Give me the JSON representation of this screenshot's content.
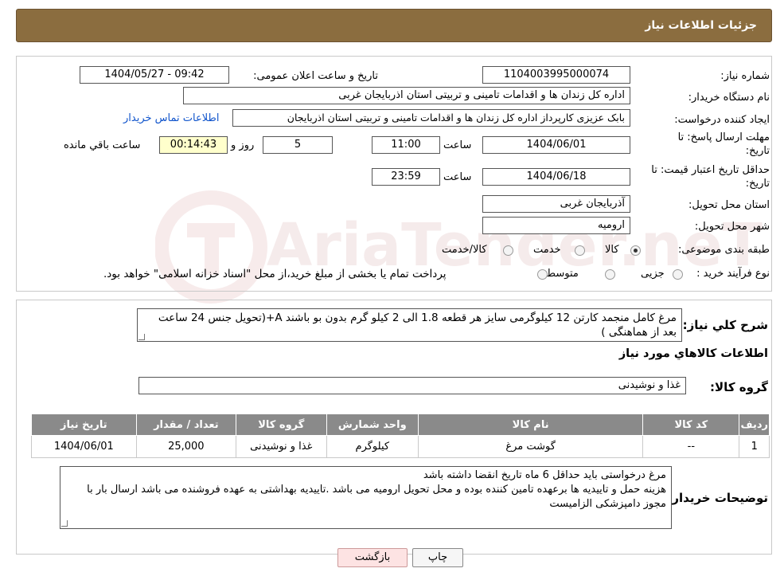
{
  "header": {
    "title": "جزئیات اطلاعات نیاز"
  },
  "form": {
    "need_number_label": "شماره نیاز:",
    "need_number": "1104003995000074",
    "announce_label": "تاریخ و ساعت اعلان عمومی:",
    "announce_value": "1404/05/27 - 09:42",
    "buyer_org_label": "نام دستگاه خریدار:",
    "buyer_org": "اداره کل زندان ها و اقدامات تامینی و تربیتی استان اذربایجان غربی",
    "creator_label": "ایجاد کننده درخواست:",
    "creator": "بابک عزیزی کارپرداز اداره کل زندان ها و اقدامات تامینی و تربیتی استان اذربایجان",
    "contact_link": "اطلاعات تماس خریدار",
    "deadline_label_1": "مهلت ارسال پاسخ: تا",
    "deadline_label_2": "تاریخ:",
    "deadline_date": "1404/06/01",
    "time_label": "ساعت",
    "deadline_time": "11:00",
    "days_value": "5",
    "days_label": "روز و",
    "remaining_time": "00:14:43",
    "remaining_label": "ساعت باقي مانده",
    "validity_label_1": "حداقل تاریخ اعتبار قیمت: تا",
    "validity_label_2": "تاریخ:",
    "validity_date": "1404/06/18",
    "validity_time": "23:59",
    "province_label": "استان محل تحویل:",
    "province": "آذربایجان غربی",
    "city_label": "شهر محل تحویل:",
    "city": "ارومیه",
    "category_label": "طبقه بندی موضوعی:",
    "category_options": [
      "کالا",
      "خدمت",
      "کالا/خدمت"
    ],
    "category_selected": "کالا",
    "process_label": "نوع فرآیند خرید :",
    "process_options": [
      "جزیی",
      "متوسط"
    ],
    "process_note": "پرداخت تمام یا بخشی از مبلغ خرید،از محل \"اسناد خزانه اسلامی\" خواهد بود."
  },
  "summary": {
    "label": "شرح كلي نياز:",
    "text": "مرغ کامل منجمد کارتن 12 کیلوگرمی سایز هر قطعه 1.8 الی 2 کیلو گرم بدون بو باشند A+(تحویل جنس 24 ساعت بعد از هماهنگی )"
  },
  "items_section": {
    "title": "اطلاعات كالاهاي مورد نياز",
    "group_label": "گروه کالا:",
    "group_value": "غذا و نوشیدنی",
    "columns": [
      "رديف",
      "کد کالا",
      "نام کالا",
      "واحد شمارش",
      "گروه کالا",
      "تعداد / مقدار",
      "تاریخ نیاز"
    ],
    "rows": [
      [
        "1",
        "--",
        "گوشت مرغ",
        "کیلوگرم",
        "غذا و نوشیدنی",
        "25,000",
        "1404/06/01"
      ]
    ]
  },
  "buyer_notes": {
    "label": "توضیحات خریدار:",
    "lines": [
      "مرغ درخواستی باید حداقل 6 ماه تاریخ انقضا داشته باشد",
      "هزینه حمل و تاییدیه ها برعهده تامین کننده بوده و محل تحویل ارومیه می باشد .تاییدیه بهداشتی به عهده فروشنده می باشد ارسال بار با مجوز دامپزشکی الزامیست"
    ]
  },
  "buttons": {
    "print": "چاپ",
    "back": "بازگشت"
  },
  "watermark": {
    "text": "AriaTender.neT"
  },
  "colors": {
    "header_bg": "#8b6d3f",
    "table_header_bg": "#8a8a8a",
    "link": "#1155cc"
  }
}
